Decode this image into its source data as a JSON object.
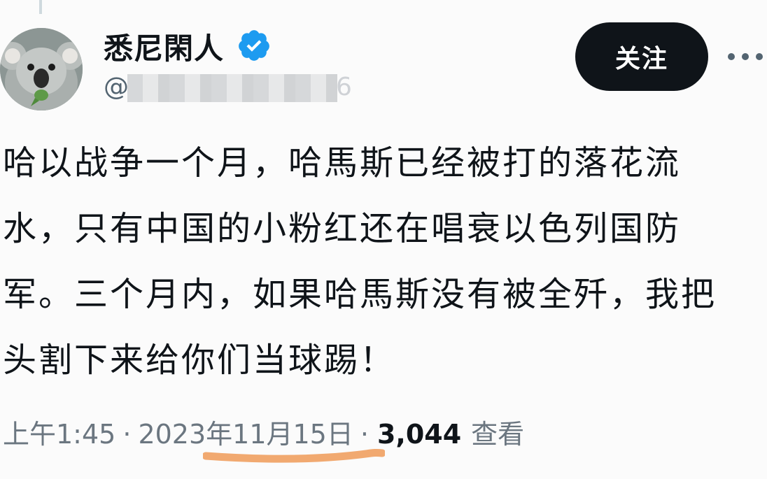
{
  "author": {
    "display_name": "悉尼閑人",
    "handle_prefix": "@",
    "handle_tail": "6"
  },
  "follow_label": "关注",
  "more_icon": "ellipsis-icon",
  "tweet": {
    "lines": [
      "哈以战争一个月，哈馬斯已经被打的落花流",
      "水，只有中国的小粉红还在唱衰以色列国防",
      "军。三个月内，如果哈馬斯没有被全歼，我把",
      "头割下来给你们当球踢！"
    ]
  },
  "meta": {
    "time": "上午1:45",
    "date": "2023年11月15日",
    "separator": "·",
    "views_count": "3,044",
    "views_label": "查看"
  },
  "colors": {
    "follow_bg": "#0f1419",
    "verified": "#1d9bf0",
    "meta_text": "#6b7680",
    "highlight_underline": "#f0a060"
  }
}
